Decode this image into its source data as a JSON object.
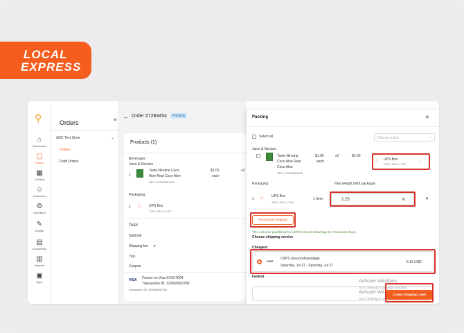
{
  "brand": {
    "line1": "LOCAL",
    "line2": "EXPRESS",
    "color": "#f45d1d"
  },
  "rail": {
    "items": [
      {
        "icon": "⌂",
        "label": "Dashboard"
      },
      {
        "icon": "▢",
        "label": "Orders"
      },
      {
        "icon": "▦",
        "label": "Catalog"
      },
      {
        "icon": "☺",
        "label": "Customers"
      },
      {
        "icon": "⚙",
        "label": "Operation"
      },
      {
        "icon": "✎",
        "label": "Design"
      },
      {
        "icon": "▤",
        "label": "Accounting"
      },
      {
        "icon": "▥",
        "label": "Reports"
      },
      {
        "icon": "▣",
        "label": "Apps"
      }
    ]
  },
  "subnav": {
    "title": "Orders",
    "collapse": "≡",
    "store": "ADC Test Store",
    "links": [
      "Orders",
      "Draft Orders"
    ]
  },
  "order": {
    "back": "←",
    "number": "Order #7283454",
    "status": "Packing"
  },
  "products": {
    "title": "Products (1)",
    "category": "Beverages",
    "subcategory": "Juice & Nectars",
    "item": {
      "qty": "1",
      "name_line1": "Taste Nirvana Coco",
      "name_line2": "Aloe Real Coco Aloe",
      "upc": "UPC: 011209801133",
      "price": "$1.00",
      "unit": "each",
      "mult": "x2"
    },
    "packaging_label": "Packaging",
    "package": {
      "qty": "1",
      "name": "UPS Box",
      "dims": "7.62 x 25.4 x 7.62"
    },
    "total_label": "Total",
    "rows": [
      "Subtotal",
      "Shipping fee",
      "Tips",
      "Coupon"
    ],
    "shipping_fee_icon": "✕",
    "payment": {
      "brand": "VISA",
      "line1": "Frozen on Visa XXXX7004",
      "line2": "Transaction ID: 120659002788",
      "line3": "Transaction ID: 120659002788"
    }
  },
  "packing": {
    "title": "Packing",
    "close": "✕",
    "select_all": "Select all",
    "choose_box": "Choose a box",
    "category": "Juice & Nectars",
    "item": {
      "name_line1": "Taste Nirvana",
      "name_line2": "Coco Aloe Real",
      "name_line3": "Coco Aloe",
      "upc": "UPC: 011209801133",
      "price": "$1.00",
      "unit": "each",
      "mult": "x2",
      "total": "$2.00"
    },
    "assigned_box": {
      "name": "UPS Box",
      "dims": "7.62 x 25.4 x 7.62"
    },
    "packaging_label": "Packaging",
    "weight_label": "Total weight (with package)",
    "package": {
      "qty": "1",
      "name": "UPS Box",
      "dims": "7.62 x 25.4 x 7.62",
      "items": "1 Item",
      "weight": "2.25",
      "unit": "lb",
      "remove": "✕"
    },
    "recalc": "Recalculate shipping",
    "paid_note": "The customer paid $6.16 for USPS Ground Advantage (1-2 Business days)",
    "service_title": "Choose shipping service",
    "cheapest_label": "Cheapest",
    "cheapest": {
      "carrier": "USPS",
      "service": "USPS Ground Advantage",
      "dates": "Saturday, Jul 27 - Saturday, Jul 27",
      "price": "6.16 USD"
    },
    "fastest_label": "Fastest",
    "create_label": "Create Shipping Label",
    "watermark_title": "Activate Windows",
    "watermark_sub": "Go to Settings to activate Windows."
  },
  "colors": {
    "accent": "#f45d1d",
    "highlight": "#d8322c",
    "badge_bg": "#cfe6f7"
  }
}
